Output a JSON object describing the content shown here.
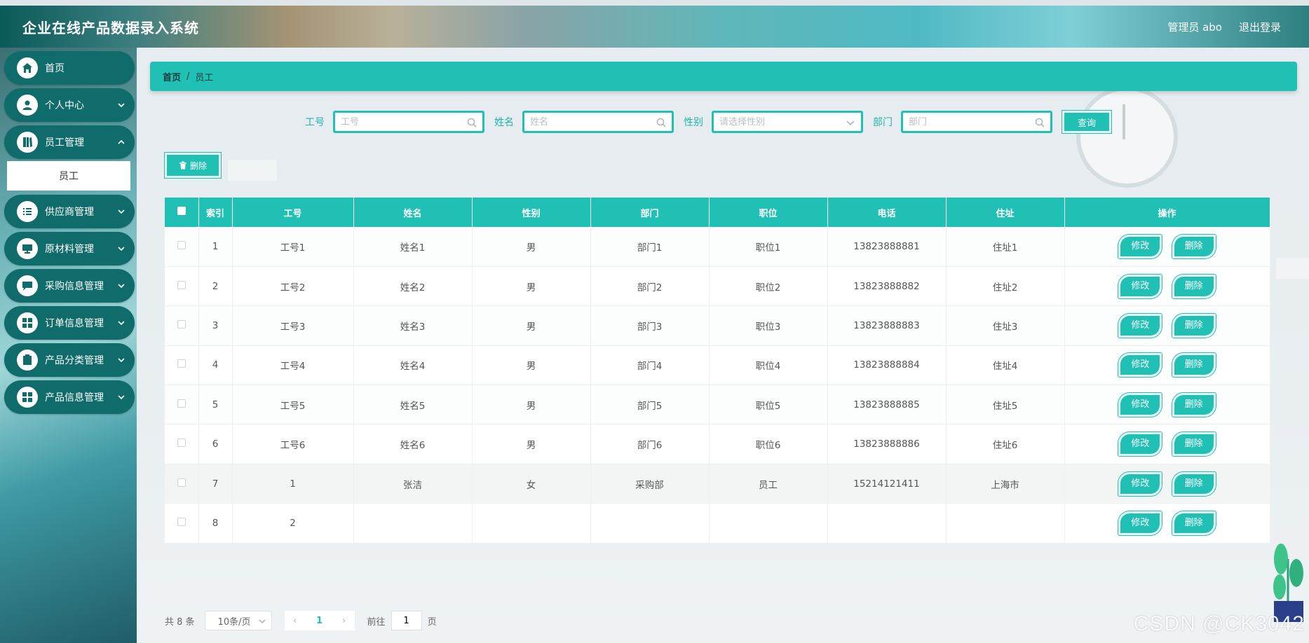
{
  "header": {
    "title": "企业在线产品数据录入系统",
    "user_label": "管理员 abo",
    "logout_label": "退出登录"
  },
  "sidebar": {
    "items": [
      {
        "label": "首页",
        "icon": "home-icon"
      },
      {
        "label": "个人中心",
        "icon": "user-icon"
      },
      {
        "label": "员工管理",
        "icon": "book-icon"
      },
      {
        "label": "供应商管理",
        "icon": "list-icon"
      },
      {
        "label": "原材料管理",
        "icon": "monitor-icon"
      },
      {
        "label": "采购信息管理",
        "icon": "chat-icon"
      },
      {
        "label": "订单信息管理",
        "icon": "grid-icon"
      },
      {
        "label": "产品分类管理",
        "icon": "clipboard-icon"
      },
      {
        "label": "产品信息管理",
        "icon": "grid-icon"
      }
    ],
    "sub_item": "员工"
  },
  "breadcrumb": {
    "home": "首页",
    "separator": "/",
    "current": "员工"
  },
  "search": {
    "gonghao_label": "工号",
    "gonghao_placeholder": "工号",
    "name_label": "姓名",
    "name_placeholder": "姓名",
    "gender_label": "性别",
    "gender_placeholder": "请选择性别",
    "dept_label": "部门",
    "dept_placeholder": "部门",
    "query_button": "查询"
  },
  "toolbar": {
    "delete_label": "删除"
  },
  "table": {
    "headers": [
      "索引",
      "工号",
      "姓名",
      "性别",
      "部门",
      "职位",
      "电话",
      "住址",
      "操作"
    ],
    "edit_label": "修改",
    "delete_label": "删除",
    "rows": [
      {
        "index": "1",
        "gonghao": "工号1",
        "name": "姓名1",
        "gender": "男",
        "dept": "部门1",
        "position": "职位1",
        "phone": "13823888881",
        "address": "住址1"
      },
      {
        "index": "2",
        "gonghao": "工号2",
        "name": "姓名2",
        "gender": "男",
        "dept": "部门2",
        "position": "职位2",
        "phone": "13823888882",
        "address": "住址2"
      },
      {
        "index": "3",
        "gonghao": "工号3",
        "name": "姓名3",
        "gender": "男",
        "dept": "部门3",
        "position": "职位3",
        "phone": "13823888883",
        "address": "住址3"
      },
      {
        "index": "4",
        "gonghao": "工号4",
        "name": "姓名4",
        "gender": "男",
        "dept": "部门4",
        "position": "职位4",
        "phone": "13823888884",
        "address": "住址4"
      },
      {
        "index": "5",
        "gonghao": "工号5",
        "name": "姓名5",
        "gender": "男",
        "dept": "部门5",
        "position": "职位5",
        "phone": "13823888885",
        "address": "住址5"
      },
      {
        "index": "6",
        "gonghao": "工号6",
        "name": "姓名6",
        "gender": "男",
        "dept": "部门6",
        "position": "职位6",
        "phone": "13823888886",
        "address": "住址6"
      },
      {
        "index": "7",
        "gonghao": "1",
        "name": "张洁",
        "gender": "女",
        "dept": "采购部",
        "position": "员工",
        "phone": "15214121411",
        "address": "上海市"
      },
      {
        "index": "8",
        "gonghao": "2",
        "name": "",
        "gender": "",
        "dept": "",
        "position": "",
        "phone": "",
        "address": ""
      }
    ]
  },
  "pager": {
    "total": "共 8 条",
    "page_size": "10条/页",
    "current_page": "1",
    "goto_prefix": "前往",
    "goto_value": "1",
    "goto_suffix": "页"
  },
  "watermark": "CSDN @CK3042",
  "colors": {
    "accent": "#21c0b5",
    "sidebar_item": "#106b6b"
  }
}
